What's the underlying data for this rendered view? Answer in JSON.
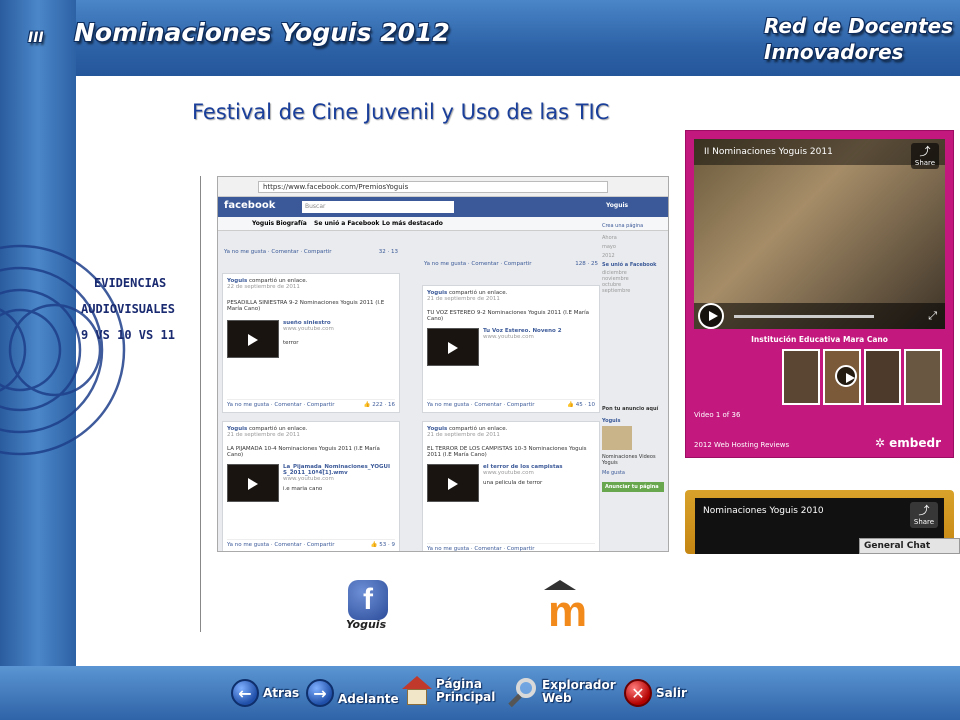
{
  "header": {
    "series_mark": "III",
    "title": "Nominaciones Yoguis 2012",
    "network_line1": "Red de Docentes",
    "network_line2": "Innovadores"
  },
  "main": {
    "heading": "Festival de Cine Juvenil y Uso de las TIC",
    "evidence_lines": [
      "EVIDENCIAS",
      "AUDIOVISUALES",
      "9 VS 10 VS 11"
    ]
  },
  "facebook_screenshot": {
    "url": "https://www.facebook.com/PremiosYoguis",
    "logo": "facebook",
    "search_placeholder": "Buscar",
    "page_name": "Yoguis",
    "nav_items": [
      "Yoguis",
      "Biografía",
      "Se unió a Facebook",
      "Lo más destacado"
    ],
    "posts": [
      {
        "author": "Yoguis",
        "date": "22 de septiembre de 2011",
        "text": "PESADILLA SINIESTRA 9-2 Nominaciones Yoguis 2011 (I.E María Cano)",
        "link": "sueño siniestro",
        "domain": "www.youtube.com",
        "desc": "terror",
        "likes": "222",
        "comments": "16"
      },
      {
        "author": "Yoguis",
        "date": "21 de septiembre de 2011",
        "text": "TU VOZ ESTEREO 9-2 Nominaciones Yoguis 2011 (I.E María Cano)",
        "link": "Tu Voz Estereo. Noveno 2",
        "domain": "www.youtube.com",
        "desc": "",
        "likes": "45",
        "comments": "10"
      },
      {
        "author": "Yoguis",
        "date": "21 de septiembre de 2011",
        "text": "LA PIJAMADA 10-4 Nominaciones Yoguis 2011 (I.E María Cano)",
        "link": "La_Pijamada_Nominaciones_YOGUIS_2011_10ª4[1].wmv",
        "domain": "www.youtube.com",
        "desc": "i.e maria cano",
        "likes": "53",
        "comments": "9"
      },
      {
        "author": "Yoguis",
        "date": "21 de septiembre de 2011",
        "text": "EL TERROR DE LOS CAMPISTAS 10-3 Nominaciones Yoguis 2011 (I.E María Cano)",
        "link": "el terror de los campistas",
        "domain": "www.youtube.com",
        "desc": "una pelicula de terror",
        "likes": "",
        "comments": ""
      }
    ],
    "top_likes": [
      "32",
      "13",
      "128",
      "25"
    ],
    "action_links": "Ya no me gusta · Comentar · Compartir",
    "sidebar": [
      "Crea una página",
      "Ahora",
      "mayo",
      "2012",
      "Se unió a Facebook",
      "diciembre",
      "noviembre",
      "octubre",
      "septiembre",
      "Pon tu anuncio aquí",
      "Yoguis",
      "Nominaciones Videos Yoguis",
      "Me gusta",
      "Anunciar tu página"
    ]
  },
  "video1": {
    "title": "II Nominaciones Yoguis 2011",
    "share": "Share",
    "caption": "Institución Educativa Mara Cano",
    "counter": "Video 1 of 36",
    "footer": "2012 Web Hosting Reviews",
    "brand": "embedr"
  },
  "video2": {
    "title": "Nominaciones Yoguis 2010",
    "share": "Share",
    "chat": "General Chat"
  },
  "logos": {
    "facebook_label": "Yoguis"
  },
  "bottom_nav": {
    "back": "Atras",
    "forward": "Adelante",
    "home_line1": "Página",
    "home_line2": "Principal",
    "browser_line1": "Explorador",
    "browser_line2": "Web",
    "exit": "Salir"
  },
  "colors": {
    "frame_blue": "#2e63a8",
    "heading_blue": "#1a3f9a",
    "embed_magenta": "#c3197f",
    "facebook_blue": "#3b5998"
  }
}
